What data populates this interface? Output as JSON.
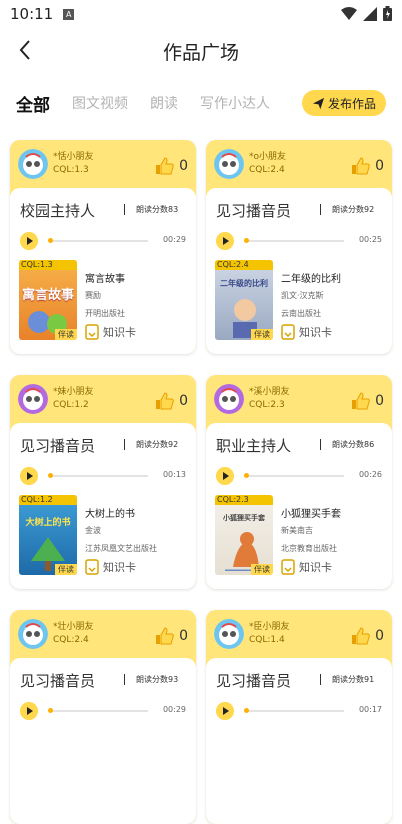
{
  "status_bar": {
    "time": "10:11",
    "a_icon": "A"
  },
  "header": {
    "title": "作品广场"
  },
  "tabs": [
    {
      "label": "全部",
      "active": true
    },
    {
      "label": "图文视频",
      "active": false
    },
    {
      "label": "朗读",
      "active": false
    },
    {
      "label": "写作小达人",
      "active": false
    }
  ],
  "publish_button": {
    "label": "发布作品"
  },
  "cards": [
    {
      "user_name": "*恬小朋友",
      "user_cql": "CQL:1.3",
      "likes": "0",
      "role": "校园主持人",
      "score": "朗读分数83",
      "duration": "00:29",
      "book_title": "寓言故事",
      "book_author": "赛励",
      "book_publisher": "开明出版社",
      "book_cql": "CQL:1.3",
      "cover_text": "寓言故事",
      "read_tag": "伴读",
      "knowledge_card": "知识卡"
    },
    {
      "user_name": "*o小朋友",
      "user_cql": "CQL:2.4",
      "likes": "0",
      "role": "见习播音员",
      "score": "朗读分数92",
      "duration": "00:25",
      "book_title": "二年级的比利",
      "book_author": "凯文·汉克斯",
      "book_publisher": "云南出版社",
      "book_cql": "CQL:2.4",
      "cover_text": "二年级的比利",
      "read_tag": "伴读",
      "knowledge_card": "知识卡"
    },
    {
      "user_name": "*妹小朋友",
      "user_cql": "CQL:1.2",
      "likes": "0",
      "role": "见习播音员",
      "score": "朗读分数92",
      "duration": "00:13",
      "book_title": "大树上的书",
      "book_author": "金波",
      "book_publisher": "江苏凤凰文艺出版社",
      "book_cql": "CQL:1.2",
      "cover_text": "大树上的书",
      "read_tag": "伴读",
      "knowledge_card": "知识卡"
    },
    {
      "user_name": "*溪小朋友",
      "user_cql": "CQL:2.3",
      "likes": "0",
      "role": "职业主持人",
      "score": "朗读分数86",
      "duration": "00:26",
      "book_title": "小狐狸买手套",
      "book_author": "新美南吉",
      "book_publisher": "北京教育出版社",
      "book_cql": "CQL:2.3",
      "cover_text": "小狐狸买手套",
      "read_tag": "伴读",
      "knowledge_card": "知识卡"
    },
    {
      "user_name": "*壮小朋友",
      "user_cql": "CQL:2.4",
      "likes": "0",
      "role": "见习播音员",
      "score": "朗读分数93",
      "duration": "00:29",
      "book_title": "",
      "book_author": "",
      "book_publisher": "",
      "book_cql": "",
      "cover_text": "",
      "read_tag": "",
      "knowledge_card": ""
    },
    {
      "user_name": "*臣小朋友",
      "user_cql": "CQL:1.4",
      "likes": "0",
      "role": "见习播音员",
      "score": "朗读分数91",
      "duration": "00:17",
      "book_title": "",
      "book_author": "",
      "book_publisher": "",
      "book_cql": "",
      "cover_text": "",
      "read_tag": "",
      "knowledge_card": ""
    }
  ],
  "colors": {
    "accent": "#ffd84d",
    "card_header": "#ffe57a",
    "avatar_blue": "#6ec6f0",
    "avatar_purple": "#b36ae0"
  },
  "icons": [
    "back-arrow-icon",
    "send-icon",
    "thumbs-up-icon",
    "play-icon",
    "knowledge-card-icon",
    "wifi-icon",
    "signal-icon",
    "battery-icon"
  ]
}
